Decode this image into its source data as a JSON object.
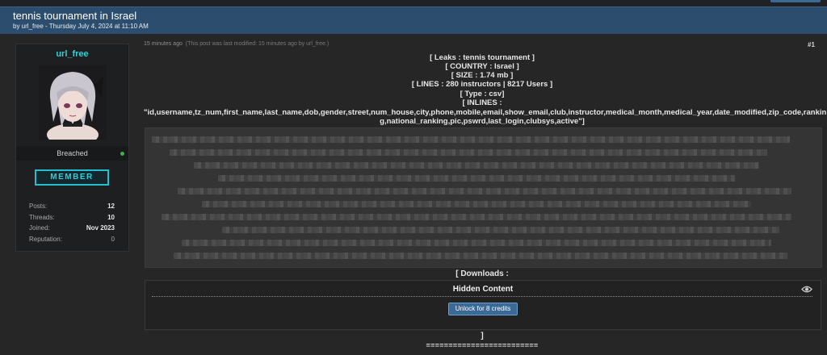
{
  "thread": {
    "title": "tennis tournament in Israel",
    "subtitle": "by url_free - Thursday July 4, 2024 at 11:10 AM"
  },
  "profile": {
    "username": "url_free",
    "rank": "Breached",
    "badge": "MEMBER",
    "stats": [
      {
        "label": "Posts:",
        "value": "12"
      },
      {
        "label": "Threads:",
        "value": "10"
      },
      {
        "label": "Joined:",
        "value": "Nov 2023"
      },
      {
        "label": "Reputation:",
        "value": "0"
      }
    ],
    "avatar_icon": "anime-avatar",
    "online_status_color": "#39b44a"
  },
  "post": {
    "time": "15 minutes ago",
    "edit_note": "(This post was last modified: 15 minutes ago by url_free.)",
    "number": "#1",
    "lines": [
      "[ Leaks : tennis tournament ]",
      "[ COUNTRY : Israel ]",
      "[ SIZE : 1.74 mb ]",
      "[ LINES : 280 instructors | 8217 Users ]",
      "[ Type : csv]",
      "[ INLINES :",
      "\"id,username,tz_num,first_name,last_name,dob,gender,street,num_house,city,phone,mobile,email,show_email,club,instructor,medical_month,medical_year,date_modified,zip_code,rankin",
      "g,national_ranking,pic,pswrd,last_login,clubsys,active\"]"
    ],
    "downloads_label": "[ Downloads :",
    "hidden": {
      "title": "Hidden Content",
      "button": "Unlock for 8 credits"
    },
    "closing_bracket": "]",
    "separator": "========================="
  },
  "colors": {
    "header_bg": "#2c4d6e",
    "username": "#35d0d8",
    "badge": "#23bfd0",
    "button": "#3b6a96"
  }
}
